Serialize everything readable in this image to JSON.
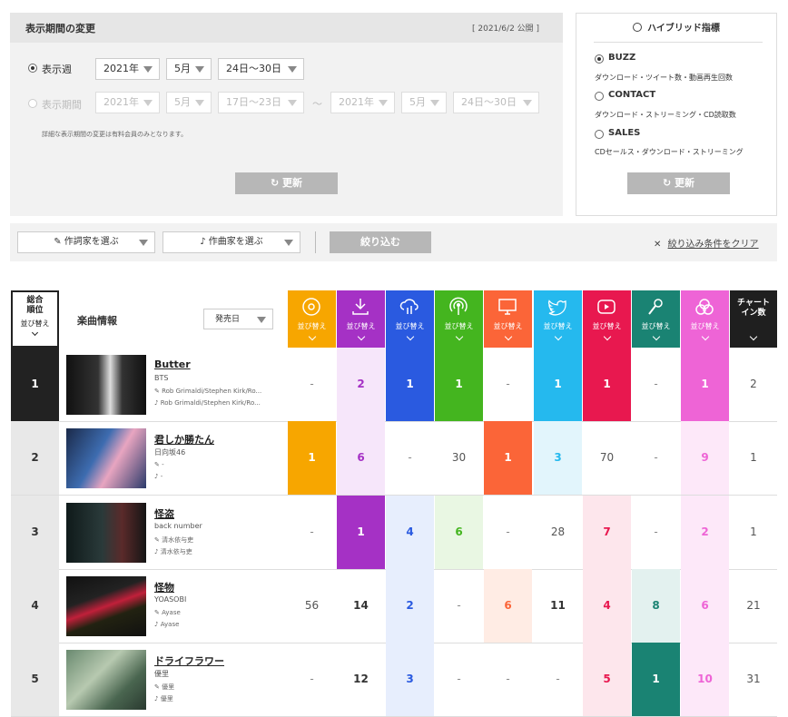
{
  "period": {
    "title": "表示期間の変更",
    "published": "[ 2021/6/2 公開 ]",
    "weekly_label": "表示週",
    "weekly_year": "2021年",
    "weekly_month": "5月",
    "weekly_range": "24日〜30日",
    "period_label": "表示期間",
    "from_year": "2021年",
    "from_month": "5月",
    "from_range": "17日〜23日",
    "tilde": "〜",
    "to_year": "2021年",
    "to_month": "5月",
    "to_range": "24日〜30日",
    "note": "詳細な表示期間の変更は有料会員のみとなります。",
    "update": "更新"
  },
  "hybrid": {
    "title": "ハイブリッド指標",
    "options": [
      {
        "label": "BUZZ",
        "desc": "ダウンロード・ツイート数・動画再生回数"
      },
      {
        "label": "CONTACT",
        "desc": "ダウンロード・ストリーミング・CD読取数"
      },
      {
        "label": "SALES",
        "desc": "CDセールス・ダウンロード・ストリーミング"
      }
    ],
    "update": "更新"
  },
  "filter": {
    "lyricist": "作詞家を選ぶ",
    "composer": "作曲家を選ぶ",
    "apply": "絞り込む",
    "clear": "絞り込み条件をクリア"
  },
  "table": {
    "rank_header": "総合\n順位",
    "sort": "並び替え",
    "song_info": "楽曲情報",
    "release_sort": "発売日",
    "chart_in": "チャート\nイン数",
    "columns": [
      {
        "name": "cd-icon",
        "color": "#f7a600"
      },
      {
        "name": "download-icon",
        "color": "#a531c5"
      },
      {
        "name": "streaming-icon",
        "color": "#2a5ae0"
      },
      {
        "name": "radio-icon",
        "color": "#44b51f"
      },
      {
        "name": "pc-read-icon",
        "color": "#fb6538"
      },
      {
        "name": "twitter-icon",
        "color": "#25b9ee"
      },
      {
        "name": "youtube-icon",
        "color": "#e8184f"
      },
      {
        "name": "karaoke-icon",
        "color": "#1a8373"
      },
      {
        "name": "gyao-icon",
        "color": "#ee64d6"
      }
    ],
    "rows": [
      {
        "rank": "1",
        "title": "Butter",
        "artist": "BTS",
        "lyricist": "Rob Grimaldi/Stephen Kirk/Ro...",
        "composer": "Rob Grimaldi/Stephen Kirk/Ro...",
        "values": [
          "-",
          "2",
          "1",
          "1",
          "-",
          "1",
          "1",
          "-",
          "1"
        ],
        "chart_in": "2"
      },
      {
        "rank": "2",
        "title": "君しか勝たん",
        "artist": "日向坂46",
        "lyricist": "-",
        "composer": "-",
        "values": [
          "1",
          "6",
          "-",
          "30",
          "1",
          "3",
          "70",
          "-",
          "9"
        ],
        "chart_in": "1"
      },
      {
        "rank": "3",
        "title": "怪盗",
        "artist": "back number",
        "lyricist": "清水依与吏",
        "composer": "清水依与吏",
        "values": [
          "-",
          "1",
          "4",
          "6",
          "-",
          "28",
          "7",
          "-",
          "2"
        ],
        "chart_in": "1"
      },
      {
        "rank": "4",
        "title": "怪物",
        "artist": "YOASOBI",
        "lyricist": "Ayase",
        "composer": "Ayase",
        "values": [
          "56",
          "14",
          "2",
          "-",
          "6",
          "11",
          "4",
          "8",
          "6"
        ],
        "chart_in": "21"
      },
      {
        "rank": "5",
        "title": "ドライフラワー",
        "artist": "優里",
        "lyricist": "優里",
        "composer": "優里",
        "values": [
          "-",
          "12",
          "3",
          "-",
          "-",
          "-",
          "5",
          "1",
          "10"
        ],
        "chart_in": "31"
      }
    ]
  }
}
